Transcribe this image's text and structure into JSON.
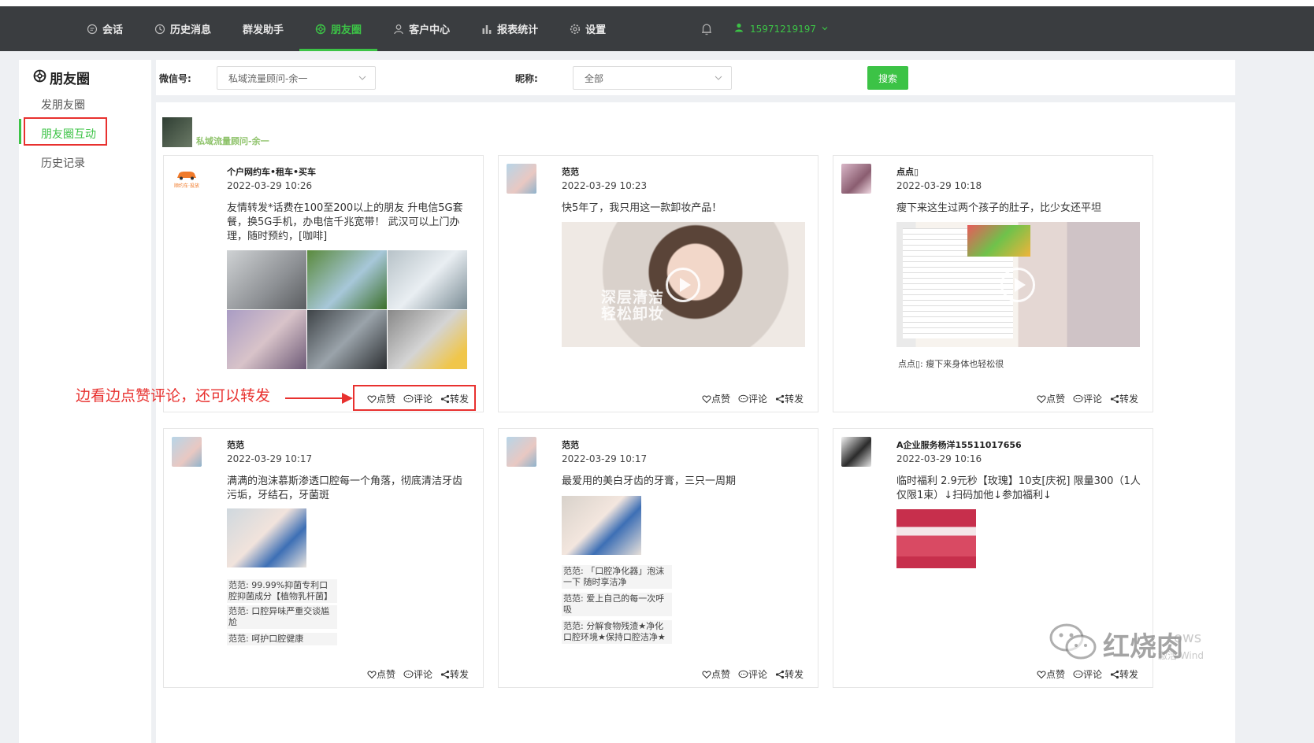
{
  "nav": {
    "items": [
      {
        "label": "会话",
        "icon": "chat-icon"
      },
      {
        "label": "历史消息",
        "icon": "clock-icon"
      },
      {
        "label": "群发助手",
        "icon": ""
      },
      {
        "label": "朋友圈",
        "icon": "moments-icon"
      },
      {
        "label": "客户中心",
        "icon": "person-icon"
      },
      {
        "label": "报表统计",
        "icon": "bar-chart-icon"
      },
      {
        "label": "设置",
        "icon": "gear-icon"
      }
    ],
    "active": "朋友圈",
    "user_phone": "15971219197",
    "accent": "#3cc346"
  },
  "sidebar": {
    "title": "朋友圈",
    "items": [
      {
        "label": "发朋友圈"
      },
      {
        "label": "朋友圈互动"
      },
      {
        "label": "历史记录"
      }
    ]
  },
  "filter": {
    "wechat_label": "微信号:",
    "wechat_value": "私域流量顾问-余一",
    "nickname_label": "昵称:",
    "nickname_value": "全部",
    "search_label": "搜索"
  },
  "account": {
    "name": "私域流量顾问-余一"
  },
  "actions": {
    "like": "点赞",
    "comment": "评论",
    "forward": "转发"
  },
  "posts": [
    {
      "name": "个户网约车•租车•买车",
      "time": "2022-03-29 10:26",
      "text": "友情转发*话费在100至200以上的朋友 升电信5G套餐，换5G手机，办电信千兆宽带！ 武汉可以上门办理，随时预约，[咖啡]",
      "avatar_caption": "顺约车·投放"
    },
    {
      "name": "范范",
      "time": "2022-03-29 10:23",
      "text": "快5年了，我只用这一款卸妆产品！",
      "video_caption": [
        "深层清洁",
        "轻松卸妆"
      ]
    },
    {
      "name": "点点▯",
      "time": "2022-03-29 10:18",
      "text": "瘦下来这生过两个孩子的肚子，比少女还平坦",
      "comments": [
        "点点▯: 瘦下来身体也轻松很"
      ]
    },
    {
      "name": "范范",
      "time": "2022-03-29 10:17",
      "text": "满满的泡沫慕斯渗透口腔每一个角落，彻底清洁牙齿污垢，牙结石，牙菌斑",
      "comments": [
        "范范: 99.99%抑菌专利口腔抑菌成分【植物乳杆菌】",
        "范范: 口腔异味严重交谈尴尬",
        "范范: 呵护口腔健康"
      ]
    },
    {
      "name": "范范",
      "time": "2022-03-29 10:17",
      "text": "最爱用的美白牙齿的牙膏，三只一周期",
      "comments": [
        "范范: 「口腔净化器」泡沫一下 随时享洁净",
        "范范: 爱上自己的每一次呼吸",
        "范范: 分解食物残渣★净化口腔环境★保持口腔洁净★"
      ]
    },
    {
      "name": "A企业服务杨洋15511017656",
      "time": "2022-03-29 10:16",
      "text": "临时福利 2.9元秒【玫瑰】10支[庆祝] 限量300（1人仅限1束）↓扫码加他↓参加福利↓"
    }
  ],
  "annotation": {
    "text": "边看边点赞评论，还可以转发"
  },
  "watermark": {
    "main": "红烧肉",
    "sub": "ows",
    "sub2": "激活 Wind"
  }
}
